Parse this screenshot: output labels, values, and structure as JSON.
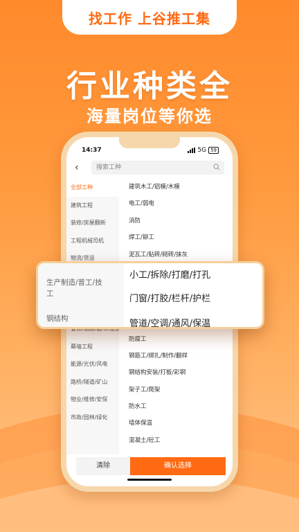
{
  "banner": {
    "tab_text": "找工作 上谷推工集"
  },
  "headline": "行业种类全",
  "subline": "海量岗位等你选",
  "status": {
    "time": "14:37",
    "network": "5G",
    "battery": "59"
  },
  "search": {
    "placeholder": "搜索工种"
  },
  "left_items": [
    {
      "label": "全部工种"
    },
    {
      "label": "建筑工程"
    },
    {
      "label": "装修/房屋翻新"
    },
    {
      "label": "工程机械司机"
    },
    {
      "label": "物流/货运"
    },
    {
      "label": ""
    },
    {
      "label": ""
    },
    {
      "label": ""
    },
    {
      "label": "餐饮/酒店/超市/旅游/批发"
    },
    {
      "label": "幕墙工程"
    },
    {
      "label": "能源/光伏/风电"
    },
    {
      "label": "路桥/隧道/矿山"
    },
    {
      "label": "物业/维修/安保"
    },
    {
      "label": "市政/园林/绿化"
    }
  ],
  "right_items": [
    {
      "label": "建筑木工/铝模/木模"
    },
    {
      "label": "电工/弱电"
    },
    {
      "label": "消防"
    },
    {
      "label": "焊工/铆工"
    },
    {
      "label": "泥瓦工/贴砖/砌砖/抹灰"
    },
    {
      "label": ""
    },
    {
      "label": ""
    },
    {
      "label": ""
    },
    {
      "label": ""
    },
    {
      "label": "防腐工"
    },
    {
      "label": "钢筋工/绑扎/制作/翻样"
    },
    {
      "label": "钢结构安装/打板/彩钢"
    },
    {
      "label": "架子工/爬架"
    },
    {
      "label": "防水工"
    },
    {
      "label": "墙体保温"
    },
    {
      "label": "混凝土/砼工"
    }
  ],
  "popup": {
    "left_items": [
      {
        "label": "生产制造/普工/技工"
      },
      {
        "label": "钢结构"
      }
    ],
    "right_items": [
      {
        "label": "小工/拆除/打磨/打孔"
      },
      {
        "label": "门窗/打胶/栏杆/护栏"
      },
      {
        "label": "管道/空调/通风/保温"
      }
    ]
  },
  "buttons": {
    "clear": "清除",
    "confirm": "确认选择"
  },
  "colors": {
    "accent": "#ff6a13",
    "bg_top": "#ff8a2c",
    "phone_frame": "#f6d7ac"
  }
}
